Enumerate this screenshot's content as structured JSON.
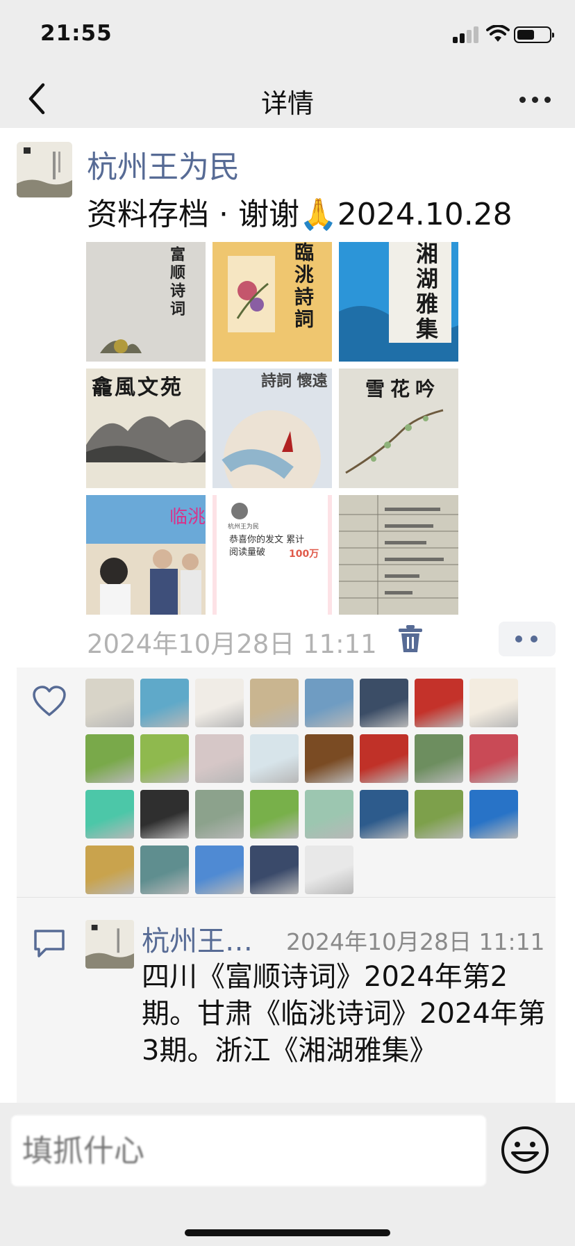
{
  "status_bar": {
    "time": "21:55"
  },
  "nav": {
    "title": "详情"
  },
  "post": {
    "author": "杭州王为民",
    "text": "资料存档 · 谢谢🙏2024.10.28",
    "photos": [
      {
        "caption": "富顺诗词",
        "bg": "#d9d7d2"
      },
      {
        "caption": "臨洮詩詞",
        "bg": "#efc66f"
      },
      {
        "caption": "湘湖雅集",
        "bg": "#2c95d8"
      },
      {
        "caption": "龕風文苑",
        "bg": "#e9e4d6"
      },
      {
        "caption": "詩詞 懷遠",
        "bg": "#dde3ea"
      },
      {
        "caption": "雪花吟",
        "bg": "#e1dfd6"
      },
      {
        "caption": "",
        "bg": "#6aa9d8"
      },
      {
        "caption": "恭喜你的发文 累计阅读量破",
        "highlight": "100万",
        "sub": "杭州王为民",
        "bg": "#ffffff"
      },
      {
        "caption": "",
        "bg": "#c9c6b9"
      }
    ],
    "time": "2024年10月28日 11:11"
  },
  "likes": {
    "avatar_colors": [
      "#d8d4c8",
      "#5fa9c9",
      "#f0ece6",
      "#c9b590",
      "#6f9cc2",
      "#3b4d66",
      "#c4322a",
      "#f3ece0",
      "#79a94a",
      "#8fb94e",
      "#d6c7c7",
      "#d7e4ea",
      "#7a4b23",
      "#c03128",
      "#6d8e5f",
      "#c94a56",
      "#4cc7a8",
      "#2f2f2f",
      "#8ca28c",
      "#78b04a",
      "#9cc6b0",
      "#2d5b8c",
      "#7da04b",
      "#2873c7",
      "#c9a34d",
      "#5f8e8f",
      "#4f8ad3",
      "#3a4a6a",
      "#e8e8e8"
    ]
  },
  "comment": {
    "author": "杭州王…",
    "time": "2024年10月28日 11:11",
    "text": "四川《富顺诗词》2024年第2期。甘肃《临洮诗词》2024年第3期。浙江《湘湖雅集》"
  },
  "input": {
    "placeholder": "填抓什心"
  }
}
